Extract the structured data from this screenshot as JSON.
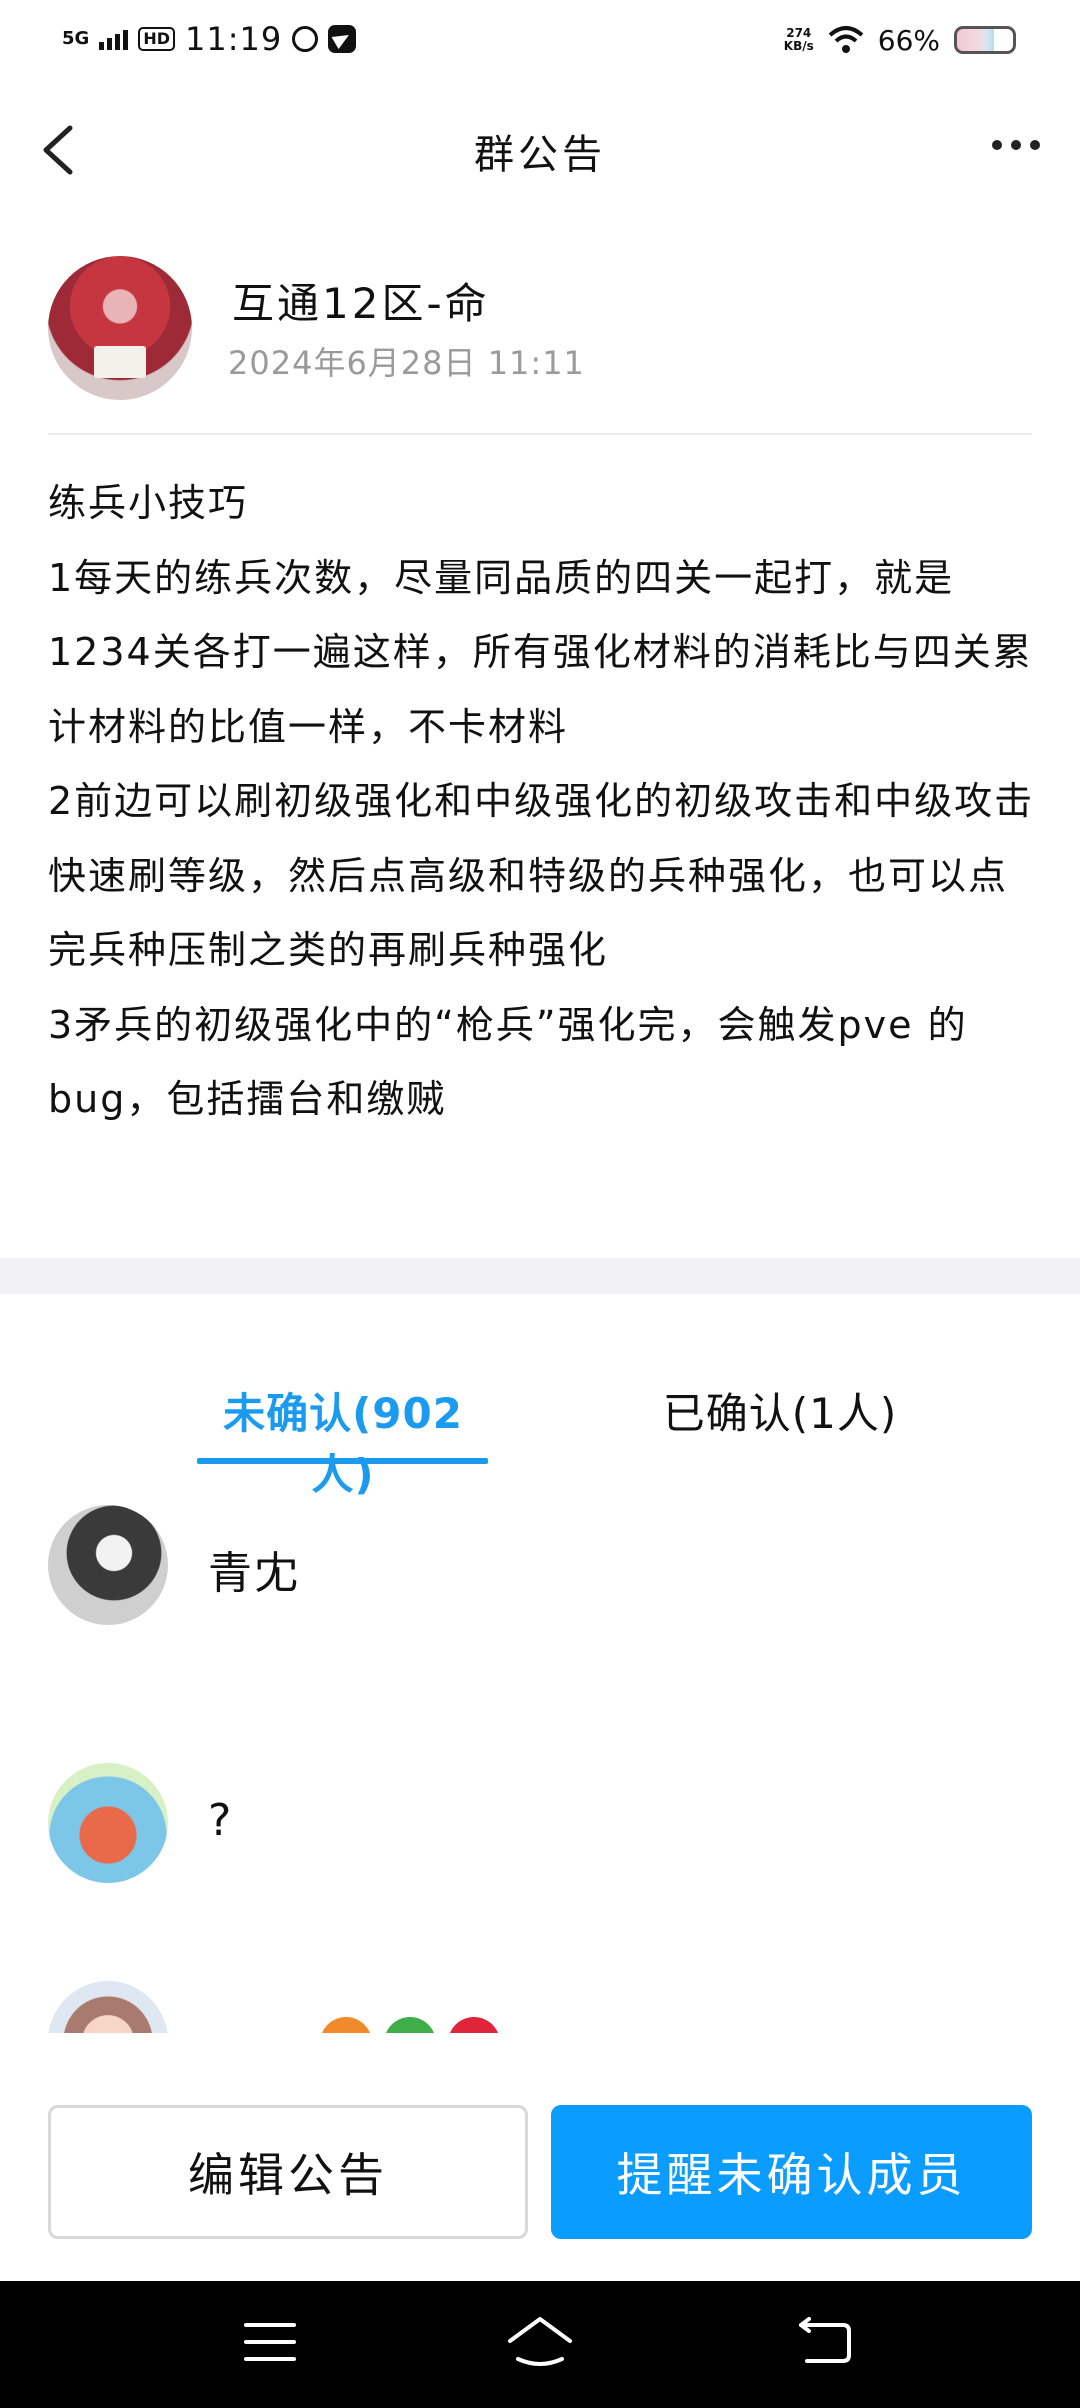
{
  "status_bar": {
    "network": "5G",
    "hd": "HD",
    "time": "11:19",
    "speed_value": "274",
    "speed_unit": "KB/s",
    "battery_text": "66%",
    "battery_level": 0.66
  },
  "nav": {
    "title": "群公告"
  },
  "author": {
    "name": "互通12区-命",
    "date": "2024年6月28日 11:11"
  },
  "notice": {
    "paragraphs": [
      "练兵小技巧",
      "1每天的练兵次数，尽量同品质的四关一起打，就是1234关各打一遍这样，所有强化材料的消耗比与四关累计材料的比值一样，不卡材料",
      "2前边可以刷初级强化和中级强化的初级攻击和中级攻击快速刷等级，然后点高级和特级的兵种强化，也可以点完兵种压制之类的再刷兵种强化",
      "3矛兵的初级强化中的“枪兵”强化完，会触发pve 的 bug，包括擂台和缴贼"
    ]
  },
  "tabs": {
    "unconfirmed": "未确认(902人)",
    "confirmed": "已确认(1人)"
  },
  "members": [
    {
      "name": "青冘"
    },
    {
      "name": "?"
    },
    {
      "name": "…"
    }
  ],
  "buttons": {
    "edit": "编辑公告",
    "remind": "提醒未确认成员"
  },
  "colors": {
    "accent": "#0a9cff",
    "tab_active": "#1a9bf0",
    "date_gray": "#9a9a9a",
    "section_gap": "#f2f2f5"
  },
  "icons": {
    "back": "chevron-left-icon",
    "more": "more-horizontal-icon",
    "menu": "menu-icon",
    "home": "home-icon",
    "back_system": "return-icon"
  }
}
